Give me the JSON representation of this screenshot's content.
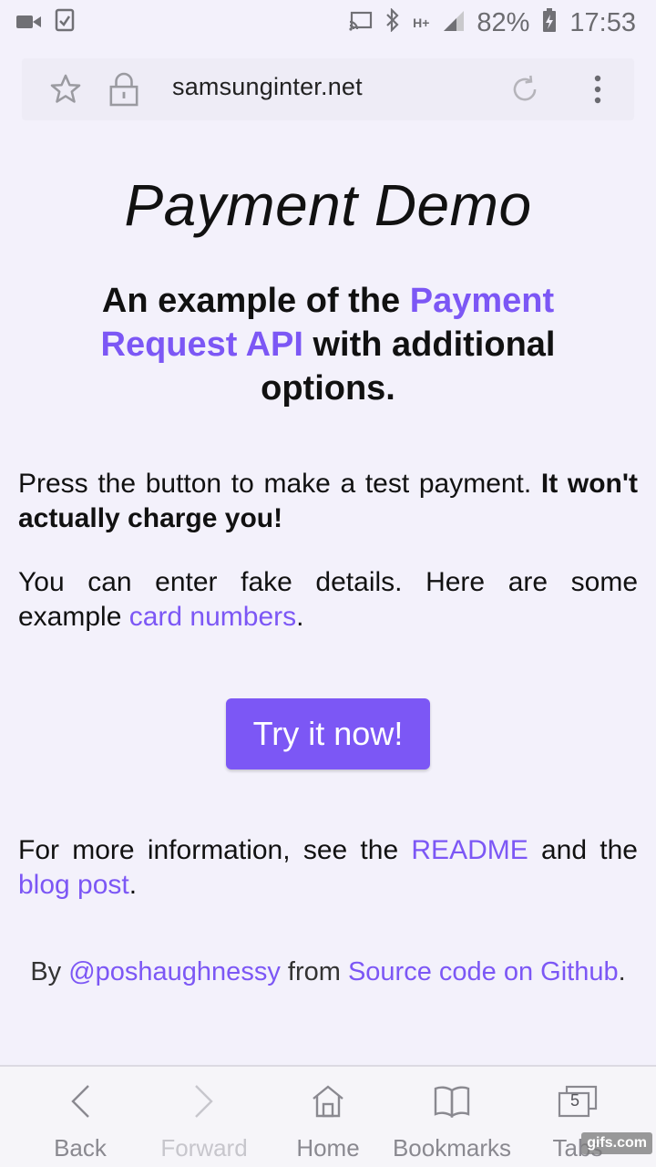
{
  "status_bar": {
    "battery": "82%",
    "time": "17:53",
    "network": "H+"
  },
  "browser": {
    "url": "samsunginter.net"
  },
  "page": {
    "title": "Payment Demo",
    "subtitle_part1": "An example of the ",
    "subtitle_link": "Payment Request API",
    "subtitle_part2": " with additional options.",
    "para1_text": "Press the button to make a test payment. ",
    "para1_bold": "It won't actually charge you!",
    "para2_text": "You can enter fake details. Here are some example ",
    "para2_link": "card numbers",
    "para2_end": ".",
    "button_label": "Try it now!",
    "para3_text": "For more information, see the ",
    "para3_link1": "README",
    "para3_mid": " and the ",
    "para3_link2": "blog post",
    "para3_end": ".",
    "footer_by": "By ",
    "footer_author": "@poshaughnessy",
    "footer_from": " from ",
    "footer_source": "Source code on Github",
    "footer_end": "."
  },
  "bottom_nav": {
    "back": "Back",
    "forward": "Forward",
    "home": "Home",
    "bookmarks": "Bookmarks",
    "tabs": "Tabs",
    "tab_count": "5"
  },
  "watermark": "gifs.com",
  "colors": {
    "accent": "#7c57f5",
    "background": "#f3f1fb"
  }
}
